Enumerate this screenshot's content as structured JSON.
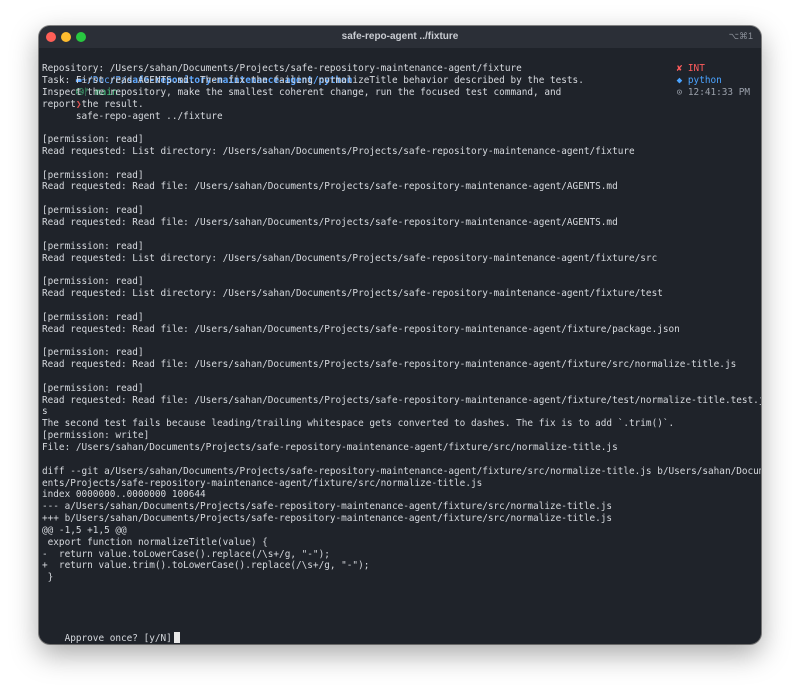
{
  "window": {
    "title": "safe-repo-agent ../fixture",
    "shortcut": "⌥⌘1"
  },
  "prompt": {
    "apple_icon": "",
    "folder_icon": "▬",
    "path_prefix": "~/Doc/P/",
    "path_bold": "safe-repository-maintenance-agent/python",
    "python_icon": "⛁",
    "git_icon": "ᚠ",
    "branch": "main",
    "separator": "❯",
    "command": "safe-repo-agent ../fixture",
    "status_mark": "✘",
    "status_text": "INT",
    "venv_icon": "◆",
    "venv_name": "python",
    "clock_icon": "⊙",
    "time": "12:41:33 PM"
  },
  "terminal": {
    "output_lines": [
      "Repository: /Users/sahan/Documents/Projects/safe-repository-maintenance-agent/fixture",
      "Task: First read AGENTS.md. Then fix the failing normalizeTitle behavior described by the tests.",
      "Inspect the repository, make the smallest coherent change, run the focused test command, and",
      "report the result.",
      "",
      "",
      "[permission: read]",
      "Read requested: List directory: /Users/sahan/Documents/Projects/safe-repository-maintenance-agent/fixture",
      "",
      "[permission: read]",
      "Read requested: Read file: /Users/sahan/Documents/Projects/safe-repository-maintenance-agent/AGENTS.md",
      "",
      "[permission: read]",
      "Read requested: Read file: /Users/sahan/Documents/Projects/safe-repository-maintenance-agent/AGENTS.md",
      "",
      "[permission: read]",
      "Read requested: List directory: /Users/sahan/Documents/Projects/safe-repository-maintenance-agent/fixture/src",
      "",
      "[permission: read]",
      "Read requested: List directory: /Users/sahan/Documents/Projects/safe-repository-maintenance-agent/fixture/test",
      "",
      "[permission: read]",
      "Read requested: Read file: /Users/sahan/Documents/Projects/safe-repository-maintenance-agent/fixture/package.json",
      "",
      "[permission: read]",
      "Read requested: Read file: /Users/sahan/Documents/Projects/safe-repository-maintenance-agent/fixture/src/normalize-title.js",
      "",
      "[permission: read]",
      "Read requested: Read file: /Users/sahan/Documents/Projects/safe-repository-maintenance-agent/fixture/test/normalize-title.test.j",
      "s",
      "The second test fails because leading/trailing whitespace gets converted to dashes. The fix is to add `.trim()`.",
      "[permission: write]",
      "File: /Users/sahan/Documents/Projects/safe-repository-maintenance-agent/fixture/src/normalize-title.js",
      "",
      "diff --git a/Users/sahan/Documents/Projects/safe-repository-maintenance-agent/fixture/src/normalize-title.js b/Users/sahan/Docum",
      "ents/Projects/safe-repository-maintenance-agent/fixture/src/normalize-title.js",
      "index 0000000..0000000 100644",
      "--- a/Users/sahan/Documents/Projects/safe-repository-maintenance-agent/fixture/src/normalize-title.js",
      "+++ b/Users/sahan/Documents/Projects/safe-repository-maintenance-agent/fixture/src/normalize-title.js",
      "@@ -1,5 +1,5 @@",
      " export function normalizeTitle(value) {",
      "-  return value.toLowerCase().replace(/\\s+/g, \"-\");",
      "+  return value.trim().toLowerCase().replace(/\\s+/g, \"-\");",
      " }"
    ],
    "input_prompt": "Approve once? [y/N]"
  }
}
